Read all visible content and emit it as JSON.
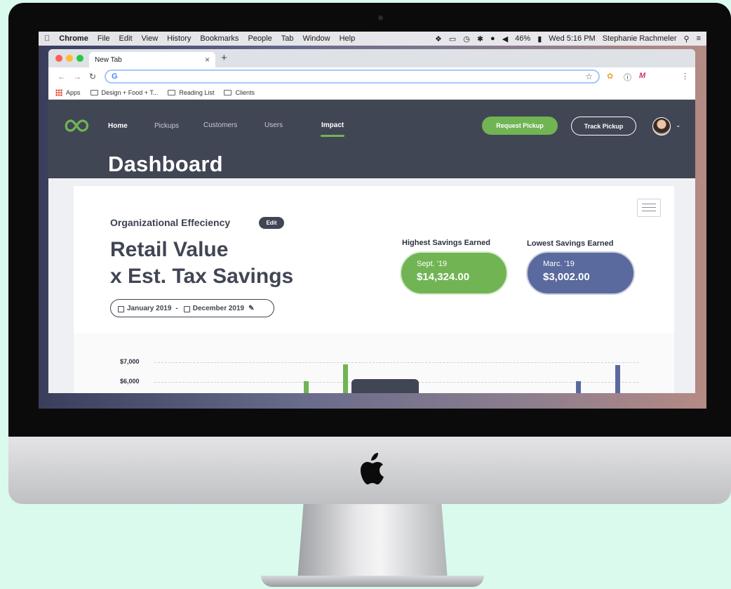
{
  "mac_menubar": {
    "apple": "",
    "app_name": "Chrome",
    "menus": [
      "File",
      "Edit",
      "View",
      "History",
      "Bookmarks",
      "People",
      "Tab",
      "Window",
      "Help"
    ],
    "battery": "46%",
    "clock": "Wed 5:16 PM",
    "user": "Stephanie Rachmeler"
  },
  "browser": {
    "tab_title": "New Tab",
    "tab_close": "×",
    "new_tab": "+",
    "omnibox_value": "",
    "bookmarks": [
      "Apps",
      "Design + Food + T...",
      "Reading List",
      "Clients"
    ]
  },
  "app": {
    "nav": [
      {
        "label": "Home",
        "active": false
      },
      {
        "label": "Pickups",
        "active": false
      },
      {
        "label": "Customers",
        "active": false
      },
      {
        "label": "Users",
        "active": false
      },
      {
        "label": "Impact",
        "active": true
      }
    ],
    "request_pickup": "Request Pickup",
    "track_pickup": "Track Pickup",
    "page_title": "Dashboard",
    "section_title": "Organizational Effeciency",
    "edit_label": "Edit",
    "main_title_line1": "Retail Value",
    "main_title_line2": "x Est. Tax Savings",
    "date_start": "January 2019",
    "date_sep": "-",
    "date_end": "December 2019",
    "highest": {
      "label": "Highest Savings Earned",
      "month": "Sept. '19",
      "amount": "$14,324.00",
      "color": "#71b454"
    },
    "lowest": {
      "label": "Lowest Savings Earned",
      "month": "Marc. '19",
      "amount": "$3,002.00",
      "color": "#5a6a9e"
    },
    "accent_dark": "#414654",
    "accent_green": "#71b454"
  },
  "chart_data": {
    "type": "bar",
    "y_ticks": [
      "$7,000",
      "$6,000"
    ],
    "visible_range": [
      5800,
      7000
    ],
    "series": [
      {
        "color": "#71b454",
        "values_visible": [
          {
            "x_label": "",
            "value": 6050
          },
          {
            "x_label": "",
            "value": 6900
          }
        ]
      },
      {
        "color": "#5a6a9e",
        "values_visible": [
          {
            "x_label": "",
            "value": 6050
          },
          {
            "x_label": "",
            "value": 6850
          }
        ]
      }
    ]
  }
}
